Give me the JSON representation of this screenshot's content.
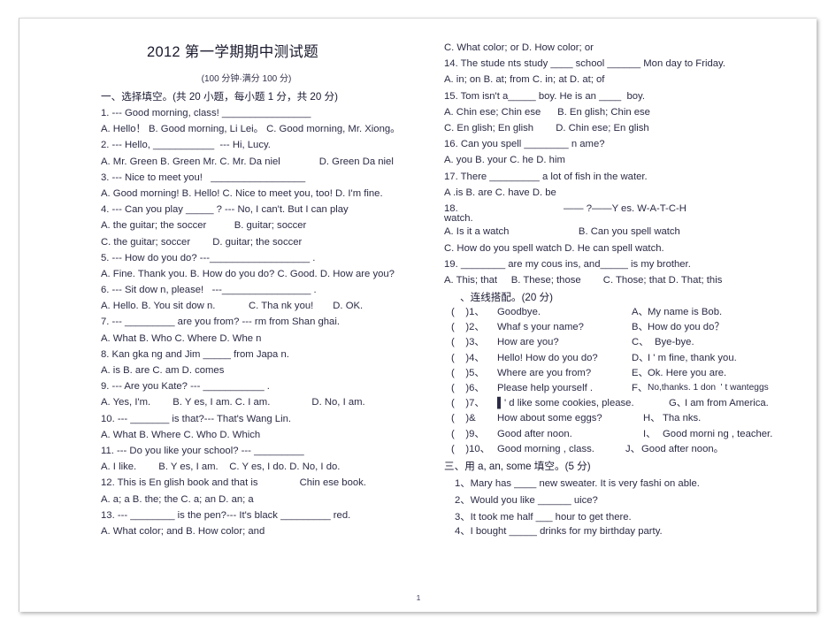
{
  "page": {
    "title": "2012 第一学期期中测试题",
    "subtitle": "(100 分钟·满分 100 分)",
    "page_number": "1"
  },
  "left_column": {
    "section_one_heading": "一、选择填空。(共 20 小题，每小题 1 分，共 20 分)",
    "lines": [
      "1. --- Good morning, class! ________________",
      "A. Hello！ B. Good morning, Li Lei。 C. Good morning, Mr. Xiong。",
      "2. --- Hello, ___________  --- Hi, Lucy.",
      "A. Mr. Green B. Green Mr. C. Mr. Da niel              D. Green Da niel",
      "3. --- Nice to meet you!   _________________",
      "A. Good morning! B. Hello! C. Nice to meet you, too! D. I'm fine.",
      "4. --- Can you play _____ ? --- No, I can't. But I can play",
      "A. the guitar; the soccer          B. guitar; soccer",
      "C. the guitar; soccer        D. guitar; the soccer",
      "5. --- How do you do? ---__________________ .",
      "A. Fine. Thank you. B. How do you do? C. Good. D. How are you?",
      "6. --- Sit dow n, please!   ---________________ .",
      "A. Hello. B. You sit dow n.            C. Tha nk you!       D. OK.",
      "7. --- _________ are you from? --- rm from Shan ghai.",
      "A. What B. Who C. Where D. Whe n",
      "8. Kan gka ng and Jim _____ from Japa n.",
      "A. is B. are C. am D. comes",
      "9. --- Are you Kate? --- ___________ .",
      "A. Yes, I'm.        B. Y es, I am. C. I am.               D. No, I am.",
      "10. --- _______ is that?--- That's Wang Lin.",
      "A. What B. Where C. Who D. Which",
      "11. --- Do you like your school? --- _________",
      "A. I like.        B. Y es, I am.    C. Y es, I do. D. No, I do.",
      "12. This is En glish book and that is               Chin ese book.",
      "A. a; a B. the; the C. a; an D. an; a",
      "13. --- ________ is the pen?--- It's black _________ red.",
      "A. What color; and B. How color; and"
    ]
  },
  "right_column": {
    "lines_top": [
      "C. What color; or D. How color; or",
      "14. The stude nts study ____ school ______ Mon day to Friday.",
      "A. in; on B. at; from C. in; at D. at; of",
      "15. Tom isn't a_____ boy. He is an ____  boy.",
      "A. Chin ese; Chin ese      B. En glish; Chin ese",
      "C. En glish; En glish        D. Chin ese; En glish",
      "16. Can you spell ________ n ame?",
      "A. you B. your C. he D. him",
      "17. There _________ a lot of fish in the water.",
      "A .is B. are C. have D. be",
      "18.                                      —— ?——Y es. W-A-T-C-H",
      "watch.",
      "A. Is it a watch                         B. Can you spell watch",
      "C. How do you spell watch D. He can spell watch.",
      "19. ________ are my cous ins, and_____ is my brother.",
      "A. This; that     B. These; those        C. Those; that D. That; this"
    ],
    "section_two_heading": "、连线搭配。(20 分)",
    "match_items": [
      {
        "num": "(    )1、",
        "prompt": "Goodbye.",
        "letter": "A、",
        "answer": "My name is Bob."
      },
      {
        "num": "(    )2、",
        "prompt": "Whaf s your name?",
        "letter": "B、",
        "answer": "How do you do？"
      },
      {
        "num": "(    )3、",
        "prompt": "How are you?",
        "letter": "C、",
        "answer": "Bye-bye."
      },
      {
        "num": "(    )4、",
        "prompt": "Hello! How do you do?",
        "letter": "D、",
        "answer": "I ' m fine, thank you."
      },
      {
        "num": "(    )5、",
        "prompt": "Where are you from?",
        "letter": "E、",
        "answer": "Ok. Here you are."
      },
      {
        "num": "(    )6、",
        "prompt": "Please help yourself .",
        "letter": "F、",
        "answer": "No,thanks. 1 don  ' t wanteggs"
      },
      {
        "num": "(    )7、",
        "prompt": "▌' d like some cookies, please.",
        "letter": "G、",
        "answer": "I am from America."
      },
      {
        "num": "(    )&",
        "prompt": "How about some eggs?",
        "letter": "H、",
        "answer": "Tha nks."
      },
      {
        "num": "(    )9、",
        "prompt": "Good after noon.",
        "letter": "I、",
        "answer": "Good morni ng , teacher."
      },
      {
        "num": "(    )10、",
        "prompt": "Good morning , class.",
        "letter": "J、",
        "answer": "Good after noon。"
      }
    ],
    "section_three_heading": "三、用 a, an, some 填空。(5 分)",
    "fill_items": [
      "1、Mary has ____ new sweater. It is very fashi on able.",
      "2、Would you like ______ uice?",
      "3、It took me half ___ hour to get there.",
      "4、I bought _____ drinks for my birthday party."
    ]
  }
}
